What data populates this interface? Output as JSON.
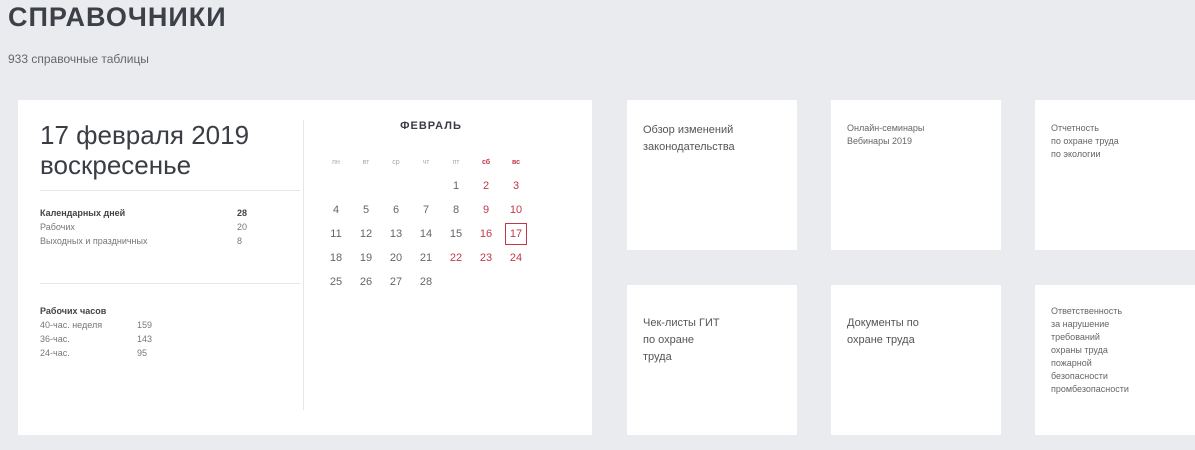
{
  "header": {
    "title": "СПРАВОЧНИКИ",
    "subtitle": "933 справочные таблицы"
  },
  "date_card": {
    "date_line": "17 февраля 2019",
    "weekday": "воскресенье",
    "days": {
      "header_label": "Календарных дней",
      "header_value": "28",
      "rows": [
        {
          "label": "Рабочих",
          "value": "20"
        },
        {
          "label": "Выходных и праздничных",
          "value": "8"
        }
      ]
    },
    "hours": {
      "header_label": "Рабочих часов",
      "rows": [
        {
          "label": "40-час. неделя",
          "value": "159"
        },
        {
          "label": "36-час.",
          "value": "143"
        },
        {
          "label": "24-час.",
          "value": "95"
        }
      ]
    }
  },
  "calendar": {
    "month": "ФЕВРАЛЬ",
    "weekdays": [
      "пн",
      "вт",
      "ср",
      "чт",
      "пт",
      "сб",
      "вс"
    ],
    "weeks": [
      [
        "",
        "",
        "",
        "",
        "1",
        "2",
        "3"
      ],
      [
        "4",
        "5",
        "6",
        "7",
        "8",
        "9",
        "10"
      ],
      [
        "11",
        "12",
        "13",
        "14",
        "15",
        "16",
        "17"
      ],
      [
        "18",
        "19",
        "20",
        "21",
        "22",
        "23",
        "24"
      ],
      [
        "25",
        "26",
        "27",
        "28",
        "",
        "",
        ""
      ]
    ],
    "highlighted": [
      "2",
      "3",
      "9",
      "10",
      "16",
      "22",
      "23",
      "24"
    ],
    "today": "17",
    "accent_color": "#c0394b"
  },
  "tiles": [
    {
      "text": "Обзор изменений\nзаконодательства"
    },
    {
      "text": "Онлайн-семинары\nВебинары 2019"
    },
    {
      "text": "Отчетность\nпо охране труда\nпо экологии"
    },
    {
      "text": "Чек-листы ГИТ\nпо охране\nтруда"
    },
    {
      "text": "Документы по\nохране труда"
    },
    {
      "text": "Ответственность\nза нарушение\nтребований\nохраны труда\nпожарной\nбезопасности\nпромбезопасности"
    }
  ]
}
